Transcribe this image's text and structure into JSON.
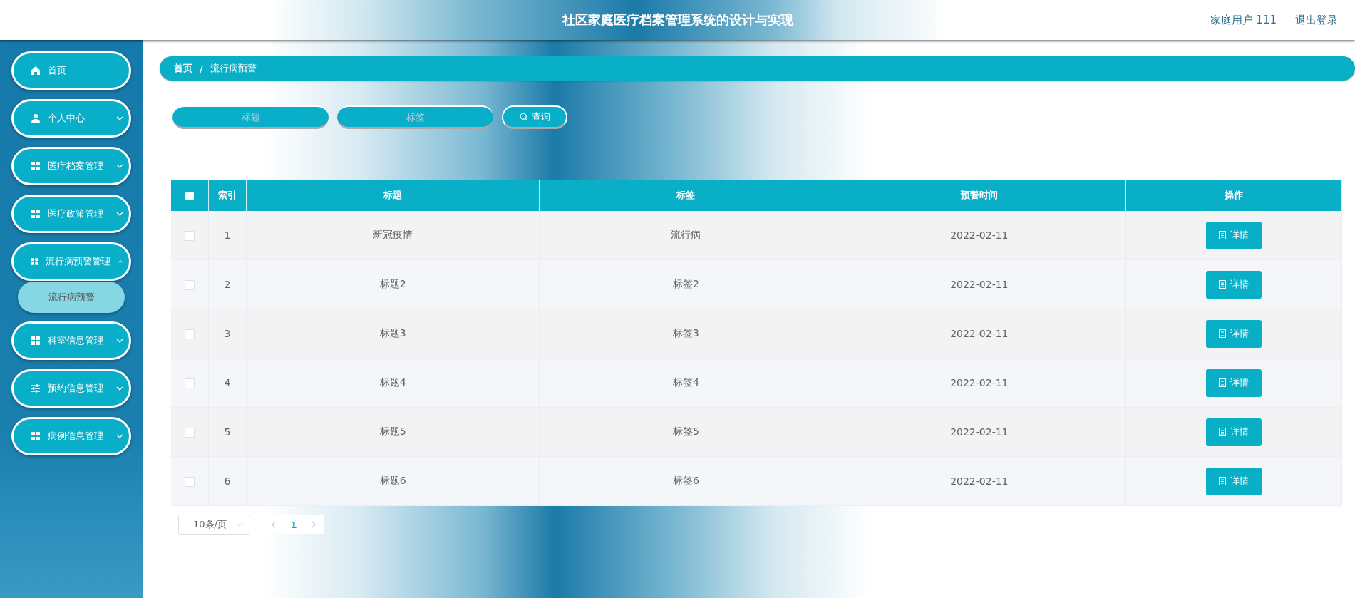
{
  "header": {
    "title": "社区家庭医疗档案管理系统的设计与实现",
    "user": "家庭用户 111",
    "logout": "退出登录"
  },
  "sidebar": {
    "items": [
      {
        "label": "首页",
        "kind": "home"
      },
      {
        "label": "个人中心",
        "kind": "user",
        "expanded": false
      },
      {
        "label": "医疗档案管理",
        "kind": "grid",
        "expanded": false
      },
      {
        "label": "医疗政策管理",
        "kind": "grid",
        "expanded": false
      },
      {
        "label": "流行病预警管理",
        "kind": "grid",
        "expanded": true,
        "children": [
          {
            "label": "流行病预警",
            "selected": true
          }
        ]
      },
      {
        "label": "科室信息管理",
        "kind": "grid",
        "expanded": false
      },
      {
        "label": "预约信息管理",
        "kind": "sliders",
        "expanded": false
      },
      {
        "label": "病例信息管理",
        "kind": "grid",
        "expanded": false
      }
    ]
  },
  "breadcrumb": {
    "separator": "/",
    "items": [
      "首页",
      "流行病预警"
    ]
  },
  "search": {
    "fields": [
      {
        "placeholder": "标题"
      },
      {
        "placeholder": "标签"
      }
    ],
    "button": "查询"
  },
  "table": {
    "select_all_checked": false,
    "columns": [
      "索引",
      "标题",
      "标签",
      "预警时间",
      "操作"
    ],
    "rows": [
      {
        "index": "1",
        "title": "新冠疫情",
        "tag": "流行病",
        "time": "2022-02-11",
        "action": "详情",
        "checked": false
      },
      {
        "index": "2",
        "title": "标题2",
        "tag": "标签2",
        "time": "2022-02-11",
        "action": "详情",
        "checked": false
      },
      {
        "index": "3",
        "title": "标题3",
        "tag": "标签3",
        "time": "2022-02-11",
        "action": "详情",
        "checked": false
      },
      {
        "index": "4",
        "title": "标题4",
        "tag": "标签4",
        "time": "2022-02-11",
        "action": "详情",
        "checked": false
      },
      {
        "index": "5",
        "title": "标题5",
        "tag": "标签5",
        "time": "2022-02-11",
        "action": "详情",
        "checked": false
      },
      {
        "index": "6",
        "title": "标题6",
        "tag": "标签6",
        "time": "2022-02-11",
        "action": "详情",
        "checked": false
      }
    ]
  },
  "pagination": {
    "page_size": "10条/页",
    "pages": [
      {
        "label": "1",
        "selected": true
      }
    ]
  }
}
